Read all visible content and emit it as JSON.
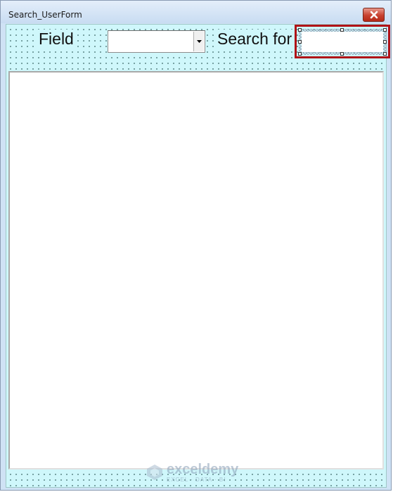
{
  "window": {
    "title": "Search_UserForm"
  },
  "form": {
    "field_label": "Field",
    "field_combo_value": "",
    "search_label": "Search for",
    "search_value": ""
  },
  "watermark": {
    "name": "exceldemy",
    "tagline": "EXCEL · DATA · BI"
  },
  "colors": {
    "form_bg": "#cff7fb",
    "selection_border": "#b01217",
    "close_button": "#c8412f"
  }
}
